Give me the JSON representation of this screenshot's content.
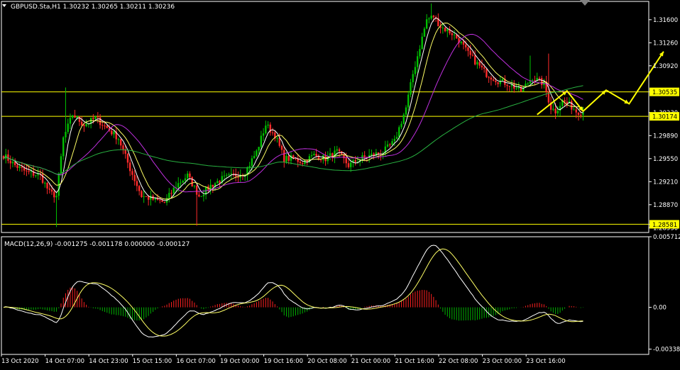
{
  "colors": {
    "background": "#000000",
    "frame": "#ffffff",
    "bull_candle": "#00c000",
    "bear_candle": "#ff2a2a",
    "ma_fast": "#ffffff",
    "ma_medium": "#ffff66",
    "ma_slow": "#c030e0",
    "ma_long": "#28b040",
    "hline": "#ffff00",
    "arrow": "#ffff00",
    "hist_pos": "#ff2020",
    "hist_neg": "#00b000",
    "macd_line": "#ffffff",
    "signal_line": "#ffff66",
    "price_tag_bg": "#ffff00",
    "price_tag_text": "#000000"
  },
  "chart_data": [
    {
      "type": "candlestick",
      "title": "GBPUSD.Sta,H1  1.30232 1.30265 1.30211 1.30236",
      "icon": "triangle-down-icon",
      "ylim": [
        1.2846,
        1.3187
      ],
      "y_ticks": [
        "1.31600",
        "1.31260",
        "1.30920",
        "1.30535",
        "1.30230",
        "1.29890",
        "1.29550",
        "1.29210",
        "1.28870",
        "1.28581",
        "1.28530"
      ],
      "horizontal_levels": [
        {
          "value": 1.30535,
          "label": "1.30535"
        },
        {
          "value": 1.30174,
          "label": "1.30174"
        },
        {
          "value": 1.28581,
          "label": "1.28581"
        }
      ],
      "price_anchors": [
        [
          0,
          1.296
        ],
        [
          5,
          1.2945
        ],
        [
          10,
          1.2935
        ],
        [
          16,
          1.293
        ],
        [
          20,
          1.2905
        ],
        [
          23,
          1.29
        ],
        [
          26,
          1.2985
        ],
        [
          30,
          1.302
        ],
        [
          35,
          1.3005
        ],
        [
          40,
          1.3015
        ],
        [
          45,
          1.3
        ],
        [
          50,
          1.2985
        ],
        [
          55,
          1.294
        ],
        [
          60,
          1.29
        ],
        [
          65,
          1.2895
        ],
        [
          70,
          1.289
        ],
        [
          75,
          1.2915
        ],
        [
          80,
          1.293
        ],
        [
          85,
          1.29
        ],
        [
          90,
          1.2915
        ],
        [
          95,
          1.2925
        ],
        [
          100,
          1.293
        ],
        [
          105,
          1.2935
        ],
        [
          110,
          1.2965
        ],
        [
          114,
          1.3005
        ],
        [
          118,
          1.299
        ],
        [
          122,
          1.2955
        ],
        [
          126,
          1.2955
        ],
        [
          130,
          1.295
        ],
        [
          135,
          1.296
        ],
        [
          140,
          1.2955
        ],
        [
          145,
          1.2965
        ],
        [
          150,
          1.2945
        ],
        [
          155,
          1.2955
        ],
        [
          160,
          1.296
        ],
        [
          165,
          1.2965
        ],
        [
          170,
          1.298
        ],
        [
          175,
          1.303
        ],
        [
          178,
          1.308
        ],
        [
          181,
          1.312
        ],
        [
          184,
          1.316
        ],
        [
          187,
          1.3165
        ],
        [
          190,
          1.315
        ],
        [
          195,
          1.314
        ],
        [
          198,
          1.313
        ],
        [
          202,
          1.311
        ],
        [
          206,
          1.3095
        ],
        [
          210,
          1.308
        ],
        [
          215,
          1.307
        ],
        [
          220,
          1.3065
        ],
        [
          225,
          1.3055
        ],
        [
          230,
          1.3075
        ],
        [
          235,
          1.3065
        ],
        [
          238,
          1.303
        ],
        [
          240,
          1.3025
        ],
        [
          243,
          1.304
        ],
        [
          246,
          1.3035
        ],
        [
          249,
          1.3025
        ],
        [
          252,
          1.3024
        ]
      ],
      "spikes": [
        {
          "bar": 23,
          "low": 1.2854
        },
        {
          "bar": 27,
          "high": 1.306
        },
        {
          "bar": 84,
          "low": 1.2856
        },
        {
          "bar": 186,
          "high": 1.3184
        },
        {
          "bar": 229,
          "high": 1.3107
        },
        {
          "bar": 237,
          "high": 1.311
        }
      ],
      "moving_averages": [
        {
          "name": "ma_fast",
          "period": 5
        },
        {
          "name": "ma_medium",
          "period": 10
        },
        {
          "name": "ma_slow",
          "period": 24
        },
        {
          "name": "ma_long",
          "period": 96
        }
      ],
      "projection_arrow": [
        [
          232,
          1.302
        ],
        [
          245,
          1.3055
        ],
        [
          252,
          1.3025
        ],
        [
          262,
          1.3056
        ],
        [
          272,
          1.3036
        ],
        [
          287,
          1.3113
        ]
      ]
    },
    {
      "type": "macd",
      "title": "MACD(12,26,9) -0.001275 -0.001178 0.000000 -0.000127",
      "ylim": [
        -0.00381,
        0.005712
      ],
      "y_ticks": [
        "0.005712",
        "0.00",
        "-0.003381"
      ],
      "components": [
        "histogram",
        "macd_line",
        "signal_line"
      ]
    }
  ],
  "x_axis": {
    "labels": [
      "13 Oct 2020",
      "14 Oct 07:00",
      "14 Oct 23:00",
      "15 Oct 15:00",
      "16 Oct 07:00",
      "19 Oct 00:00",
      "19 Oct 16:00",
      "20 Oct 08:00",
      "21 Oct 00:00",
      "21 Oct 16:00",
      "22 Oct 08:00",
      "23 Oct 00:00",
      "23 Oct 16:00"
    ]
  },
  "corner_icon": "scroll-marker-icon"
}
